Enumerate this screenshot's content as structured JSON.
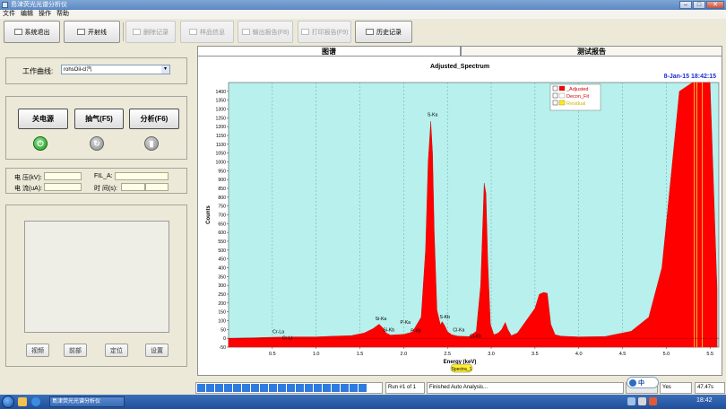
{
  "window": {
    "title": "島津荧光光谱分析仪",
    "min_glyph": "–",
    "max_glyph": "□",
    "close_glyph": "✕"
  },
  "menu": [
    "文件",
    "编辑",
    "操作",
    "帮助"
  ],
  "toolbar": {
    "exit": "系统退出",
    "open": "开射线",
    "delete": "删除记录",
    "sample_info": "样品信息",
    "export": "输出报告(F8)",
    "print": "打印报告(F9)",
    "history": "历史记录"
  },
  "left": {
    "curve_label": "工作曲线:",
    "curve_value": "rohsOil-cl汽",
    "buttons": {
      "power": "关电源",
      "pump": "抽气(F5)",
      "analyze": "分析(F6)"
    },
    "params": {
      "voltage": "电  压(kV):",
      "current": "电  流(uA):",
      "fil": "FIL_A:",
      "time": "时  间(s):"
    },
    "bottom_buttons": [
      "视频",
      "前部",
      "定位",
      "设置"
    ]
  },
  "tabs": {
    "spectrum": "图谱",
    "report": "测试报告"
  },
  "chart_data": {
    "type": "area",
    "title": "Adjusted_Spectrum",
    "timestamp": "8-Jan-15  18:42:15",
    "xlabel": "Energy (keV)",
    "ylabel": "Counts",
    "xlim": [
      0.0,
      5.6
    ],
    "ylim": [
      -50,
      1450
    ],
    "xticks": [
      "0.5",
      "1.0",
      "1.5",
      "2.0",
      "2.5",
      "3.0",
      "3.5",
      "4.0",
      "4.5",
      "5.0",
      "5.5"
    ],
    "yticks": [
      "1400",
      "1350",
      "1300",
      "1250",
      "1200",
      "1150",
      "1100",
      "1050",
      "1000",
      "950",
      "900",
      "850",
      "800",
      "750",
      "700",
      "650",
      "600",
      "550",
      "500",
      "450",
      "400",
      "350",
      "300",
      "250",
      "200",
      "150",
      "100",
      "50",
      "0",
      "-50"
    ],
    "grid": true,
    "legend_placement": "top-right",
    "legend": [
      "_Adjusted",
      "Decon_Fit",
      "Residual"
    ],
    "series_color": "#ff0000",
    "background": "#b7f0ec",
    "spectrum": {
      "x": [
        0.0,
        0.3,
        0.5,
        0.75,
        1.0,
        1.2,
        1.4,
        1.55,
        1.65,
        1.72,
        1.76,
        1.8,
        1.85,
        2.0,
        2.1,
        2.2,
        2.25,
        2.28,
        2.31,
        2.33,
        2.35,
        2.38,
        2.42,
        2.44,
        2.47,
        2.5,
        2.55,
        2.62,
        2.75,
        2.83,
        2.88,
        2.92,
        2.94,
        2.96,
        2.99,
        3.03,
        3.08,
        3.12,
        3.16,
        3.19,
        3.23,
        3.3,
        3.5,
        3.55,
        3.6,
        3.64,
        3.68,
        3.73,
        3.8,
        4.0,
        4.3,
        4.6,
        4.8,
        4.95,
        5.05,
        5.15,
        5.3,
        5.41,
        5.5,
        5.58
      ],
      "y": [
        0,
        3,
        6,
        8,
        8,
        12,
        15,
        30,
        55,
        80,
        60,
        30,
        18,
        22,
        35,
        120,
        500,
        1000,
        1230,
        1050,
        600,
        160,
        75,
        95,
        70,
        38,
        20,
        12,
        10,
        40,
        300,
        880,
        820,
        450,
        80,
        20,
        30,
        50,
        90,
        50,
        15,
        30,
        170,
        250,
        260,
        255,
        80,
        20,
        12,
        8,
        10,
        40,
        120,
        400,
        900,
        1400,
        1450,
        1450,
        1450,
        280
      ]
    },
    "markers": [
      5.32,
      5.35,
      5.41
    ],
    "peak_labels": [
      {
        "text": "Cr-La",
        "x": 0.57,
        "y": 28
      },
      {
        "text": "Cr-Ll",
        "x": 0.67,
        "y": -7
      },
      {
        "text": "Si-Ka",
        "x": 1.74,
        "y": 102
      },
      {
        "text": "Si-Kb",
        "x": 1.83,
        "y": 40
      },
      {
        "text": "P-Ka",
        "x": 2.02,
        "y": 82
      },
      {
        "text": "P-Kb",
        "x": 2.14,
        "y": 35
      },
      {
        "text": "S-Ka",
        "x": 2.33,
        "y": 1260
      },
      {
        "text": "S-Kb",
        "x": 2.47,
        "y": 112
      },
      {
        "text": "Cl-Ka",
        "x": 2.63,
        "y": 40
      },
      {
        "text": "Cl-Kb",
        "x": 2.82,
        "y": 3
      }
    ],
    "tag": "Spectra_1"
  },
  "status": {
    "run": "Run #1 of 1",
    "message": "Finished Auto Analysis...",
    "yes": "Yes",
    "percent": "47.47s"
  },
  "taskbar": {
    "app": "島津荧光光谱分析仪",
    "ime": "中",
    "time": "18:42"
  }
}
